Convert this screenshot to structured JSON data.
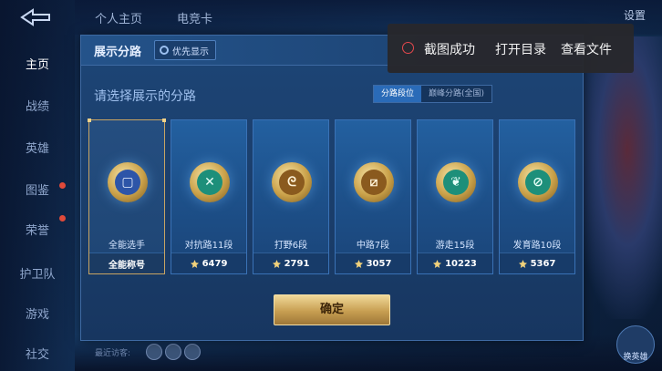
{
  "top": {
    "tabs": [
      "个人主页",
      "电竞卡"
    ],
    "settings_label": "设置"
  },
  "sidenav": {
    "items": [
      "主页",
      "战绩",
      "英雄",
      "图鉴",
      "荣誉",
      "护卫队",
      "游戏",
      "社交"
    ]
  },
  "dialog": {
    "title": "展示分路",
    "priority_label": "优先显示",
    "subtitle": "请选择展示的分路",
    "segments": [
      "分路段位",
      "巅峰分路(全国)"
    ],
    "cards": [
      {
        "label": "全能选手",
        "foot": "全能称号",
        "selected": true,
        "glyph": "▢"
      },
      {
        "label": "对抗路11段",
        "score": "6479",
        "glyph": "✕"
      },
      {
        "label": "打野6段",
        "score": "2791",
        "glyph": "ᘓ"
      },
      {
        "label": "中路7段",
        "score": "3057",
        "glyph": "⧄"
      },
      {
        "label": "游走15段",
        "score": "10223",
        "glyph": "❦"
      },
      {
        "label": "发育路10段",
        "score": "5367",
        "glyph": "⊘"
      }
    ],
    "confirm_label": "确定"
  },
  "toast": {
    "message": "截图成功",
    "open_dir": "打开目录",
    "view_file": "查看文件"
  },
  "bottom": {
    "recent_label": "最近访客:",
    "right_button_label": "换英雄"
  },
  "colors": {
    "accent_gold": "#c9a563",
    "toast_bg": "#2a2a2e",
    "toast_icon": "#e5484d"
  }
}
